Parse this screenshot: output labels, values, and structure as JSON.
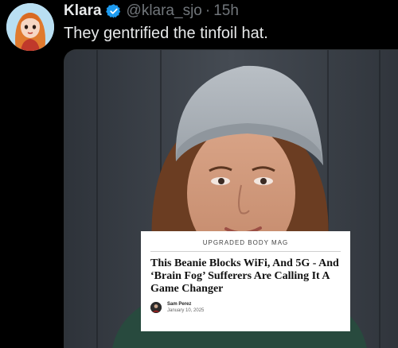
{
  "post": {
    "display_name": "Klara",
    "handle": "@klara_sjo",
    "separator": "·",
    "time": "15h",
    "text": "They gentrified the tinfoil hat.",
    "verified_icon": "verified-badge-icon",
    "accent_color": "#1d9bf0"
  },
  "article": {
    "publication": "UPGRADED BODY MAG",
    "headline": "This Beanie Blocks WiFi, And 5G - And ‘Brain Fog’ Sufferers Are Calling It A Game Changer",
    "author": "Sam Perez",
    "date": "January 10, 2025"
  },
  "colors": {
    "background": "#000000",
    "text_primary": "#e7e9ea",
    "text_secondary": "#71767b"
  }
}
